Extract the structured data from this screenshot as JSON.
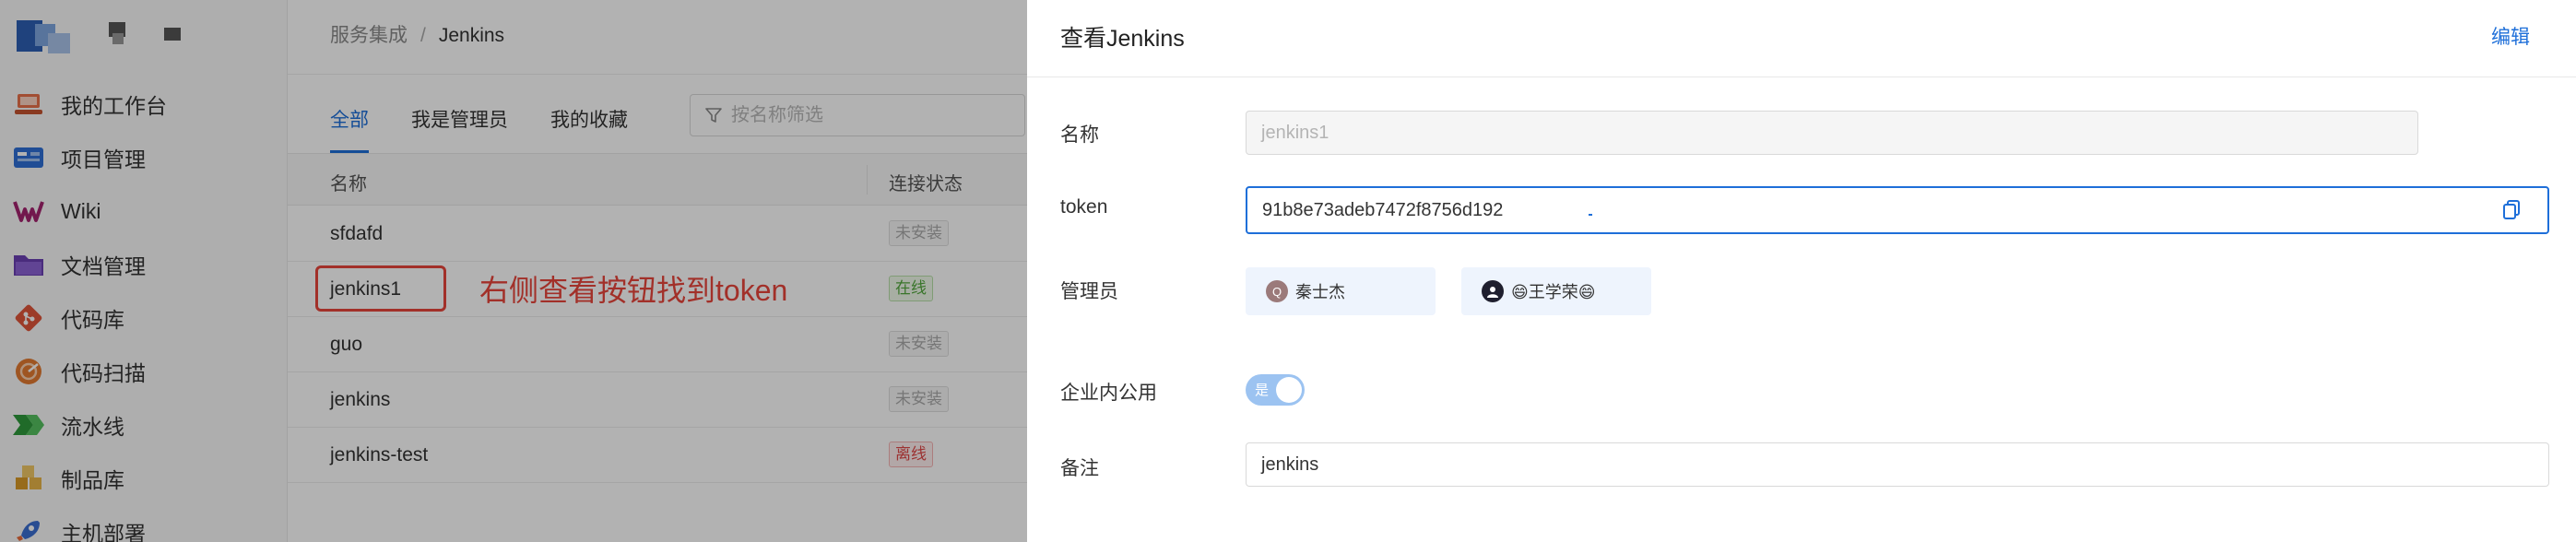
{
  "sidebar": {
    "items": [
      {
        "label": "我的工作台",
        "icon": "workbench-icon"
      },
      {
        "label": "项目管理",
        "icon": "project-icon"
      },
      {
        "label": "Wiki",
        "icon": "wiki-icon"
      },
      {
        "label": "文档管理",
        "icon": "folder-icon"
      },
      {
        "label": "代码库",
        "icon": "git-icon"
      },
      {
        "label": "代码扫描",
        "icon": "scan-icon"
      },
      {
        "label": "流水线",
        "icon": "pipeline-icon"
      },
      {
        "label": "制品库",
        "icon": "package-icon"
      },
      {
        "label": "主机部署",
        "icon": "rocket-icon"
      }
    ]
  },
  "breadcrumb": {
    "parent": "服务集成",
    "separator": "/",
    "current": "Jenkins"
  },
  "tabs": [
    "全部",
    "我是管理员",
    "我的收藏"
  ],
  "filter": {
    "placeholder": "按名称筛选"
  },
  "table": {
    "headers": {
      "name": "名称",
      "status": "连接状态"
    },
    "rows": [
      {
        "name": "sfdafd",
        "status": "未安装",
        "kind": "none"
      },
      {
        "name": "jenkins1",
        "status": "在线",
        "kind": "online"
      },
      {
        "name": "guo",
        "status": "未安装",
        "kind": "none"
      },
      {
        "name": "jenkins",
        "status": "未安装",
        "kind": "none"
      },
      {
        "name": "jenkins-test",
        "status": "离线",
        "kind": "offline"
      }
    ]
  },
  "annotation": "右侧查看按钮找到token",
  "drawer": {
    "title": "查看Jenkins",
    "edit_label": "编辑",
    "labels": {
      "name": "名称",
      "token": "token",
      "admins": "管理员",
      "enterprise": "企业内公用",
      "remark": "备注"
    },
    "name_value": "jenkins1",
    "token_value": "91b8e73adeb7472f8756d192",
    "admins": [
      {
        "initial": "Q",
        "name": "秦士杰",
        "avatar_color": "#9b7a7a"
      },
      {
        "initial": "",
        "name": "😄王学荣😄",
        "avatar_color": "#1f1f2e"
      }
    ],
    "enterprise_toggle": "是",
    "enterprise_enabled": true,
    "remark_value": "jenkins"
  },
  "colors": {
    "accent": "#1e6fd9",
    "annotation": "#e8453c"
  }
}
